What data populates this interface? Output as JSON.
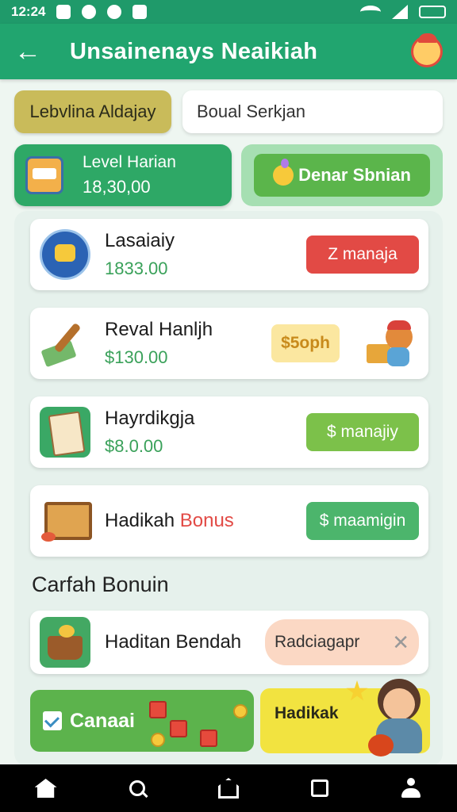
{
  "status_bar": {
    "time": "12:24",
    "battery": ""
  },
  "app_bar": {
    "title": "Unsainenays Neaikiah"
  },
  "filters": {
    "chip_label": "Lebvlina Aldajay",
    "search_value": "Boual Serkjan"
  },
  "level_card": {
    "title": "Level Harian",
    "value": "18,30,00"
  },
  "dinar_button": {
    "label": "Denar Sbnian"
  },
  "rewards": [
    {
      "name": "Lasaiaiy",
      "amount": "1833.00",
      "action": "Z manaja",
      "action_color": "#e24a45"
    },
    {
      "name": "Reval Hanljh",
      "amount": "$130.00",
      "action": "$5oph",
      "action_color": "#fbe7a0"
    },
    {
      "name": "Hayrdikgja",
      "amount": "$8.0.00",
      "action": "$ manajiy",
      "action_color": "#7cc14a"
    },
    {
      "name_plain": "Hadikah ",
      "name_highlight": "Bonus",
      "action": "$ maamigin",
      "action_color": "#4cb56c"
    }
  ],
  "section": {
    "title": "Carfah Bonuin"
  },
  "bonus_item": {
    "name": "Haditan Bendah",
    "tag": "Radciagapr"
  },
  "bottom": {
    "left_label": "Canaai",
    "right_label": "Hadikak"
  },
  "colors": {
    "primary": "#21a56f",
    "accent_red": "#e24a45",
    "accent_green": "#5cb34c",
    "accent_yellow": "#f2e340"
  }
}
